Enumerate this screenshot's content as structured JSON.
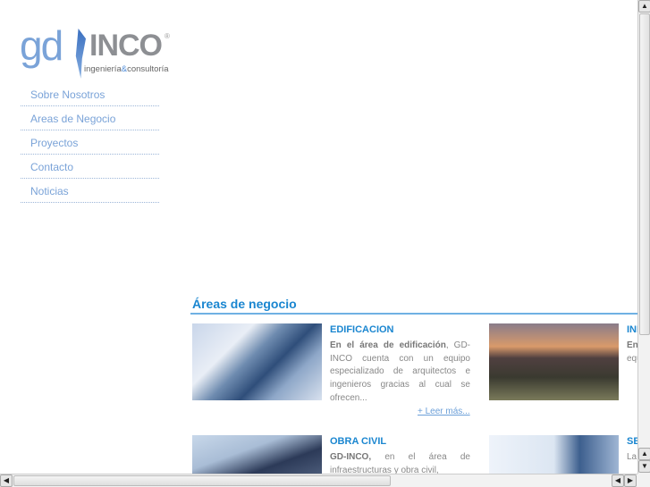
{
  "logo": {
    "main": "gd",
    "brand": "INCO",
    "sub_a": "ingeniería",
    "sub_amp": "&",
    "sub_b": "consultoría",
    "reg": "®"
  },
  "nav": [
    "Sobre Nosotros",
    "Areas de Negocio",
    "Proyectos",
    "Contacto",
    "Noticias"
  ],
  "section": {
    "title": "Áreas de negocio"
  },
  "cards": [
    {
      "title": "EDIFICACION",
      "bold": "En el área de edificación",
      "text": ", GD-INCO cuenta con un equipo especializado de arquitectos e ingenieros gracias al cual se ofrecen...",
      "more": "+ Leer más..."
    },
    {
      "title": "INDUSTRIA",
      "bold": "En",
      "text": " GD-INCO cuenta con un equipo para para"
    },
    {
      "title": "OBRA CIVIL",
      "bold": "GD-INCO,",
      "text": " en el área de infraestructuras y obra civil,"
    },
    {
      "title": "SERVICIOS",
      "bold": "",
      "text": "La es"
    }
  ]
}
